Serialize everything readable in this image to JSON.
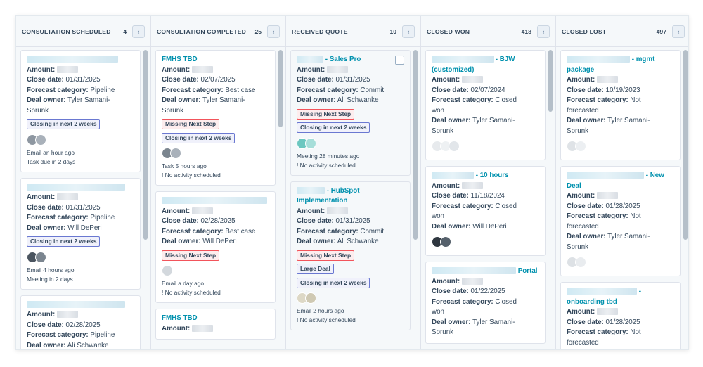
{
  "labels": {
    "amount": "Amount:",
    "close_date": "Close date:",
    "forecast": "Forecast category:",
    "owner": "Deal owner:",
    "no_activity": "! No activity scheduled"
  },
  "collapse_icon": "chevron-left-icon",
  "colors": {
    "link": "#0091ae",
    "tag_blue": "#6a78d1",
    "tag_red": "#f2545b",
    "border": "#dfe3eb"
  },
  "columns": [
    {
      "title": "CONSULTATION SCHEDULED",
      "count": "4",
      "cards": [
        {
          "title": "",
          "close_date": "01/31/2025",
          "forecast_lines": [
            "Pipeline"
          ],
          "owner_lines": [
            "Tyler Samani-",
            "Sprunk"
          ],
          "tags": [
            "Closing in next 2 weeks"
          ],
          "activity": [
            "Email an hour ago",
            "Task due in 2 days"
          ]
        },
        {
          "title": "",
          "close_date": "01/31/2025",
          "forecast_lines": [
            "Pipeline"
          ],
          "owner_lines": [
            "Will DePeri"
          ],
          "tags": [
            "Closing in next 2 weeks"
          ],
          "activity": [
            "Email 4 hours ago",
            "Meeting in 2 days"
          ]
        },
        {
          "title": "",
          "close_date": "02/28/2025",
          "forecast_lines": [
            "Pipeline"
          ],
          "owner_lines": [
            "Ali Schwanke"
          ],
          "tags": [],
          "activity": []
        }
      ]
    },
    {
      "title": "CONSULTATION COMPLETED",
      "count": "25",
      "cards": [
        {
          "title": "FMHS TBD",
          "close_date": "02/07/2025",
          "forecast_lines": [
            "Best case"
          ],
          "owner_lines": [
            "Tyler Samani-",
            "Sprunk"
          ],
          "tags": [
            "Missing Next Step",
            "Closing in next 2 weeks"
          ],
          "activity": [
            "Task 5 hours ago",
            "! No activity scheduled"
          ]
        },
        {
          "title": "",
          "close_date": "02/28/2025",
          "forecast_lines": [
            "Best case"
          ],
          "owner_lines": [
            "Will DePeri"
          ],
          "tags": [
            "Missing Next Step"
          ],
          "activity": [
            "Email a day ago",
            "! No activity scheduled"
          ]
        },
        {
          "title": "FMHS TBD",
          "close_date": "",
          "forecast_lines": [],
          "owner_lines": [],
          "tags": [],
          "activity": []
        }
      ]
    },
    {
      "title": "RECEIVED QUOTE",
      "count": "10",
      "cards": [
        {
          "title": "- Sales Pro",
          "close_date": "01/31/2025",
          "forecast_lines": [
            "Commit"
          ],
          "owner_lines": [
            "Ali Schwanke"
          ],
          "tags": [
            "Missing Next Step",
            "Closing in next 2 weeks"
          ],
          "activity": [
            "Meeting 28 minutes ago",
            "! No activity scheduled"
          ]
        },
        {
          "title": "- HubSpot Implementation",
          "close_date": "01/31/2025",
          "forecast_lines": [
            "Commit"
          ],
          "owner_lines": [
            "Ali Schwanke"
          ],
          "tags": [
            "Missing Next Step",
            "Large Deal",
            "Closing in next 2 weeks"
          ],
          "activity": [
            "Email 2 hours ago",
            "! No activity scheduled"
          ]
        }
      ]
    },
    {
      "title": "CLOSED WON",
      "count": "418",
      "cards": [
        {
          "title": "- BJW (customized)",
          "close_date": "02/07/2024",
          "forecast_lines": [
            "Closed",
            "won"
          ],
          "owner_lines": [
            "Tyler Samani-",
            "Sprunk"
          ],
          "tags": [],
          "activity": []
        },
        {
          "title": "- 10 hours",
          "close_date": "11/18/2024",
          "forecast_lines": [
            "Closed",
            "won"
          ],
          "owner_lines": [
            "Will DePeri"
          ],
          "tags": [],
          "activity": []
        },
        {
          "title": "Portal",
          "close_date": "01/22/2025",
          "forecast_lines": [
            "Closed",
            "won"
          ],
          "owner_lines": [
            "Tyler Samani-",
            "Sprunk"
          ],
          "tags": [],
          "activity": []
        }
      ]
    },
    {
      "title": "CLOSED LOST",
      "count": "497",
      "cards": [
        {
          "title": "- mgmt package",
          "close_date": "10/19/2023",
          "forecast_lines": [
            "Not",
            "forecasted"
          ],
          "owner_lines": [
            "Tyler Samani-",
            "Sprunk"
          ],
          "tags": [],
          "activity": []
        },
        {
          "title": "- New Deal",
          "close_date": "01/28/2025",
          "forecast_lines": [
            "Not",
            "forecasted"
          ],
          "owner_lines": [
            "Tyler Samani-",
            "Sprunk"
          ],
          "tags": [],
          "activity": []
        },
        {
          "title": "- onboarding tbd",
          "close_date": "01/28/2025",
          "forecast_lines": [
            "Not",
            "forecasted"
          ],
          "owner_lines": [
            "Tyler Samani-",
            "Sprunk"
          ],
          "tags": [],
          "activity": []
        }
      ]
    }
  ]
}
